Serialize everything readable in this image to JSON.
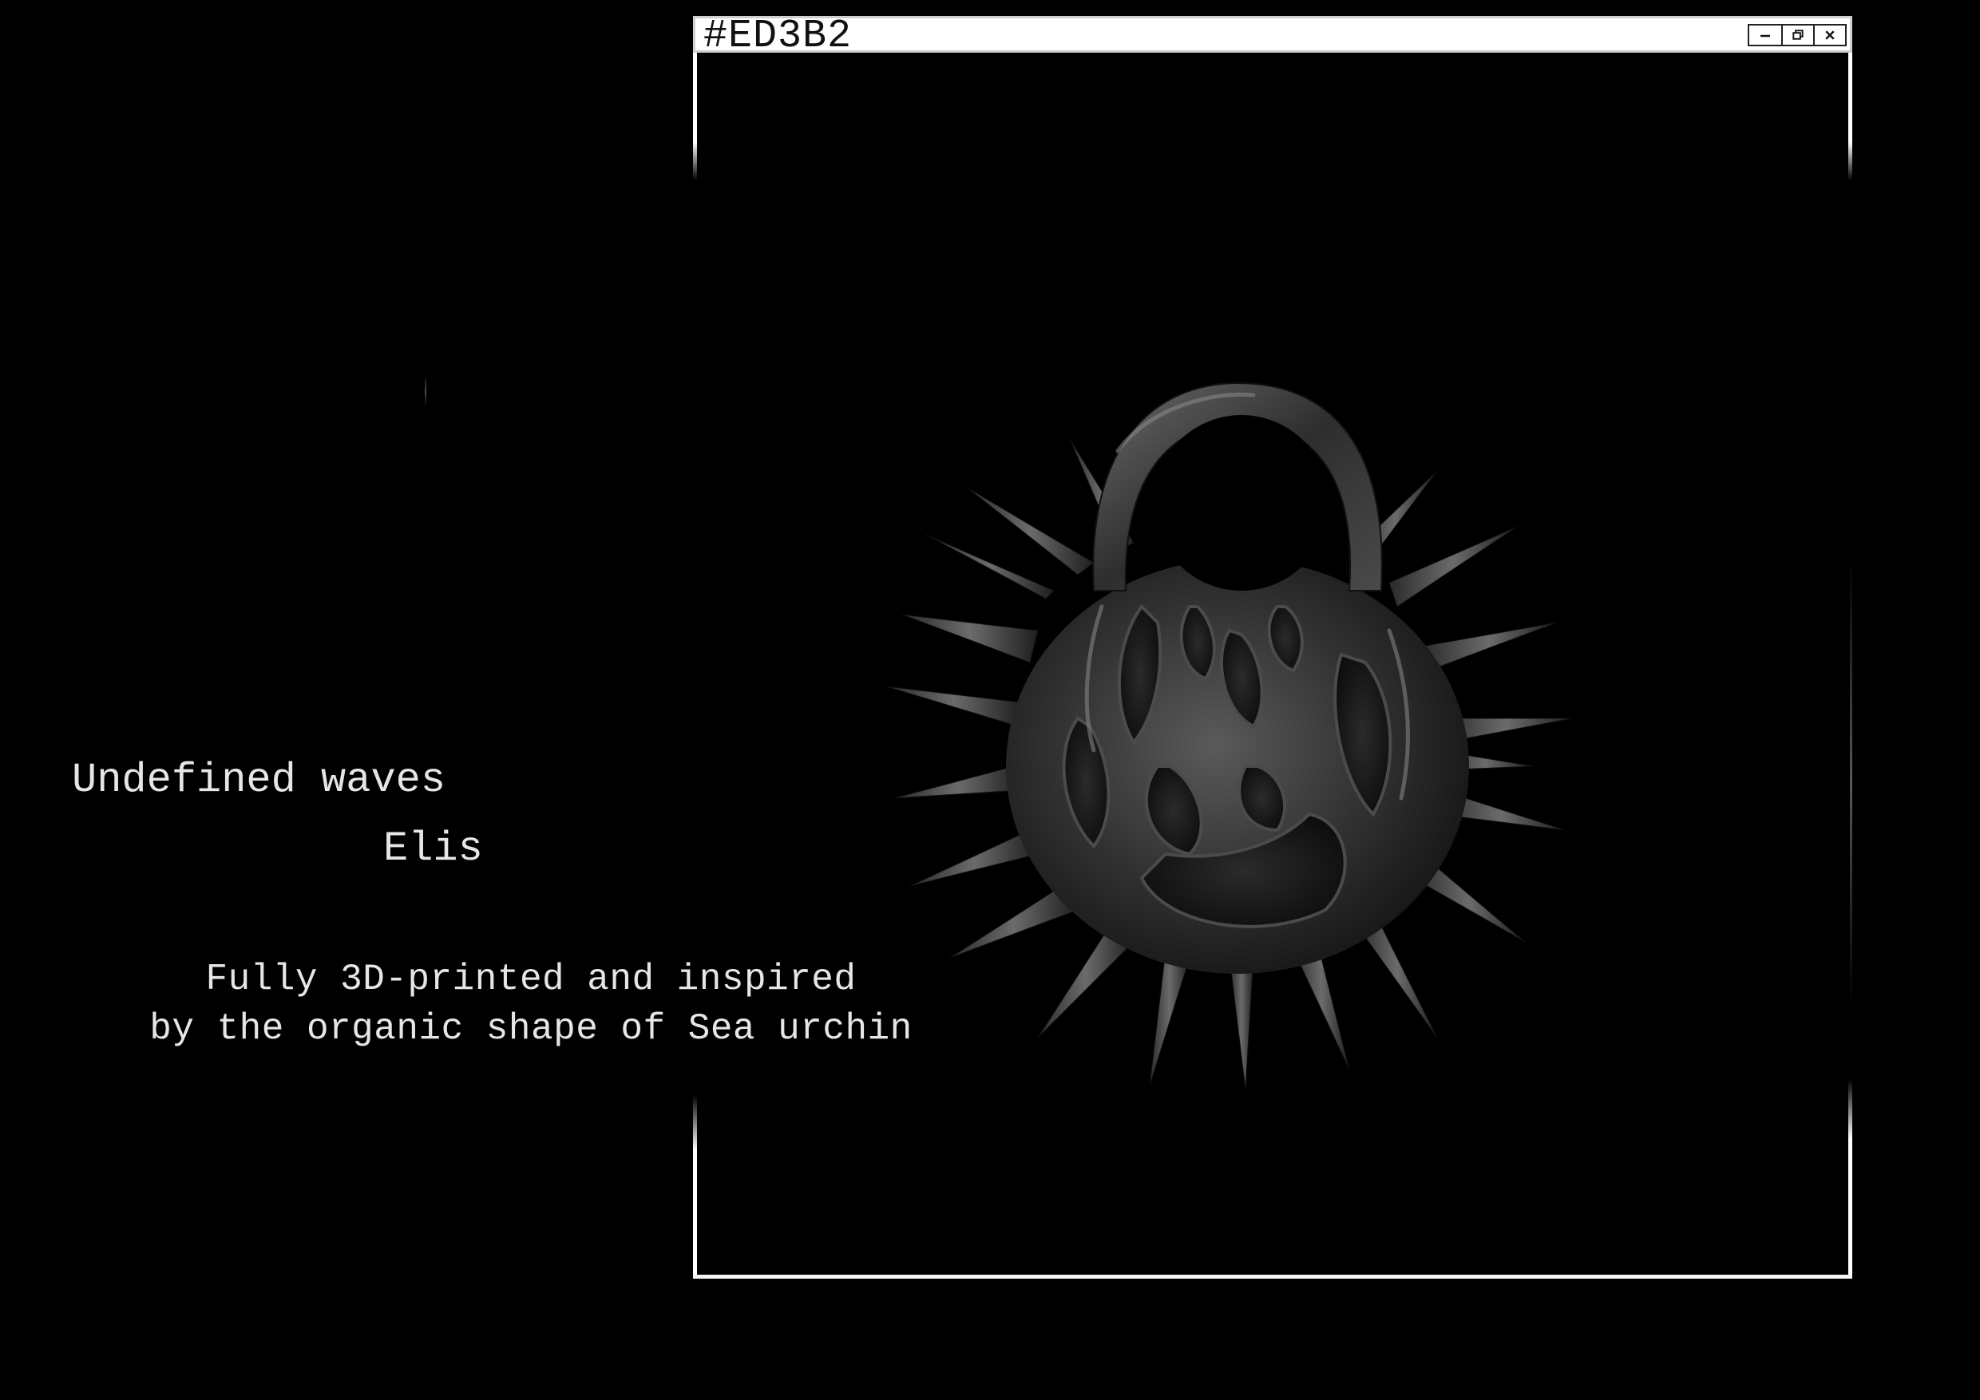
{
  "window": {
    "title": "#ED3B2",
    "controls": {
      "minimize_icon": "minimize-icon",
      "restore_icon": "restore-icon",
      "close_icon": "close-icon"
    }
  },
  "product": {
    "title": "Undefined waves",
    "designer": "Elis",
    "description_line1": "Fully 3D-printed and inspired",
    "description_line2": "by the organic shape of Sea urchin"
  },
  "colors": {
    "background": "#000000",
    "titlebar": "#ffffff",
    "text": "#e6e6e6"
  }
}
